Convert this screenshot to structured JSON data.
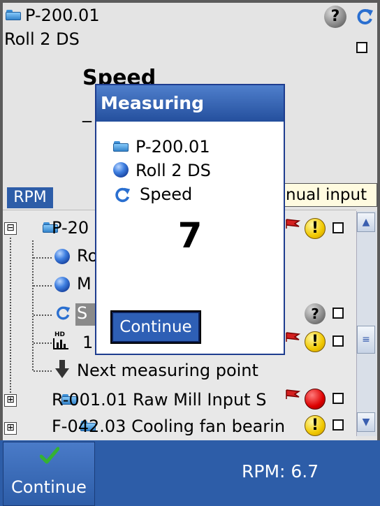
{
  "header": {
    "point_id": "P-200.01",
    "location": "Roll 2 DS",
    "measure_title": "Speed",
    "measure_underline": "_",
    "manual_input": "nual input"
  },
  "unit_tab": {
    "label": "RPM"
  },
  "tree": {
    "items": [
      {
        "label": "P-20",
        "expander": "⊟",
        "icon": "folder-icon"
      },
      {
        "label": "Ro",
        "icon": "ball-icon"
      },
      {
        "label": "M",
        "icon": "ball-icon"
      },
      {
        "label": "S",
        "icon": "refresh-icon",
        "selected": true
      },
      {
        "label": "1",
        "icon": "hd-chart-icon"
      },
      {
        "label": "Next measuring point",
        "icon": "down-arrow-icon"
      },
      {
        "label": "R-001.01 Raw Mill Input S",
        "expander": "⊞",
        "icon": "folder-icon"
      },
      {
        "label": "F-042.03 Cooling fan bearin",
        "expander": "⊞",
        "icon": "folder-icon"
      }
    ]
  },
  "dialog": {
    "title": "Measuring",
    "point": "P-200.01",
    "location": "Roll 2 DS",
    "measurement": "Speed",
    "value": "7",
    "button_label": "Continue"
  },
  "footer": {
    "continue_label": "Continue",
    "rpm_readout": "RPM: 6.7"
  },
  "colors": {
    "accent": "#2d5da8",
    "dialog_title": "#244f9d",
    "warning": "#f0c800",
    "alarm": "#d00000",
    "check": "#34b233"
  }
}
